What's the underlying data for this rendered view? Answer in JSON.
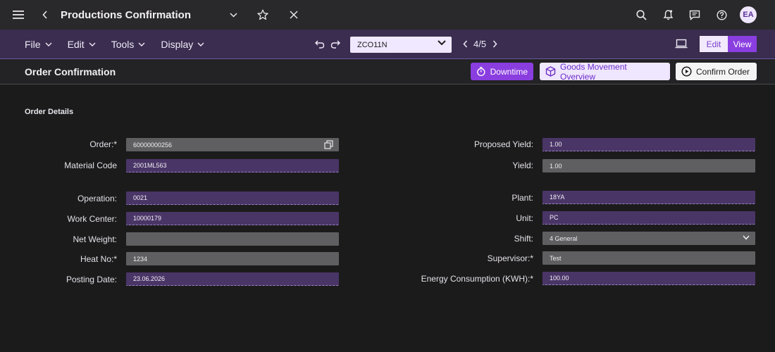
{
  "shell": {
    "title": "Productions Confirmation",
    "avatar_initials": "EA"
  },
  "toolbar": {
    "menus": [
      "File",
      "Edit",
      "Tools",
      "Display"
    ],
    "transaction_code": "ZCO11N",
    "pager": "4/5",
    "edit_label": "Edit",
    "view_label": "View"
  },
  "page": {
    "title": "Order Confirmation",
    "downtime_label": "Downtime",
    "goods_movement_label": "Goods Movement Overview",
    "confirm_label": "Confirm Order"
  },
  "form": {
    "section_title": "Order Details",
    "left": {
      "order": {
        "label": "Order:*",
        "value": "60000000256"
      },
      "material_code": {
        "label": "Material Code",
        "value": "2001ML563"
      },
      "operation": {
        "label": "Operation:",
        "value": "0021"
      },
      "work_center": {
        "label": "Work Center:",
        "value": "10000179"
      },
      "net_weight": {
        "label": "Net Weight:",
        "value": ""
      },
      "heat_no": {
        "label": "Heat No:*",
        "value": "1234"
      },
      "posting_date": {
        "label": "Posting Date:",
        "value": "23.06.2026"
      }
    },
    "right": {
      "proposed_yield": {
        "label": "Proposed Yield:",
        "value": "1.00"
      },
      "yield": {
        "label": "Yield:",
        "value": "1.00"
      },
      "plant": {
        "label": "Plant:",
        "value": "18YA"
      },
      "unit": {
        "label": "Unit:",
        "value": "PC"
      },
      "shift": {
        "label": "Shift:",
        "value": "4 General"
      },
      "supervisor": {
        "label": "Supervisor:*",
        "value": "Test"
      },
      "energy": {
        "label": "Energy Consumption (KWH):*",
        "value": "100.00"
      }
    }
  },
  "colors": {
    "accent": "#8a3ee0",
    "toolbar_bg": "#3a2d4f",
    "editable_field": "#4a3567",
    "readonly_field": "#5f5e61"
  },
  "icons": {
    "menu": "hamburger-icon",
    "back": "chevron-left-icon",
    "favorite": "star-icon",
    "close": "close-icon",
    "search": "search-icon",
    "notifications": "bell-icon",
    "messages": "message-icon",
    "help": "help-icon"
  }
}
